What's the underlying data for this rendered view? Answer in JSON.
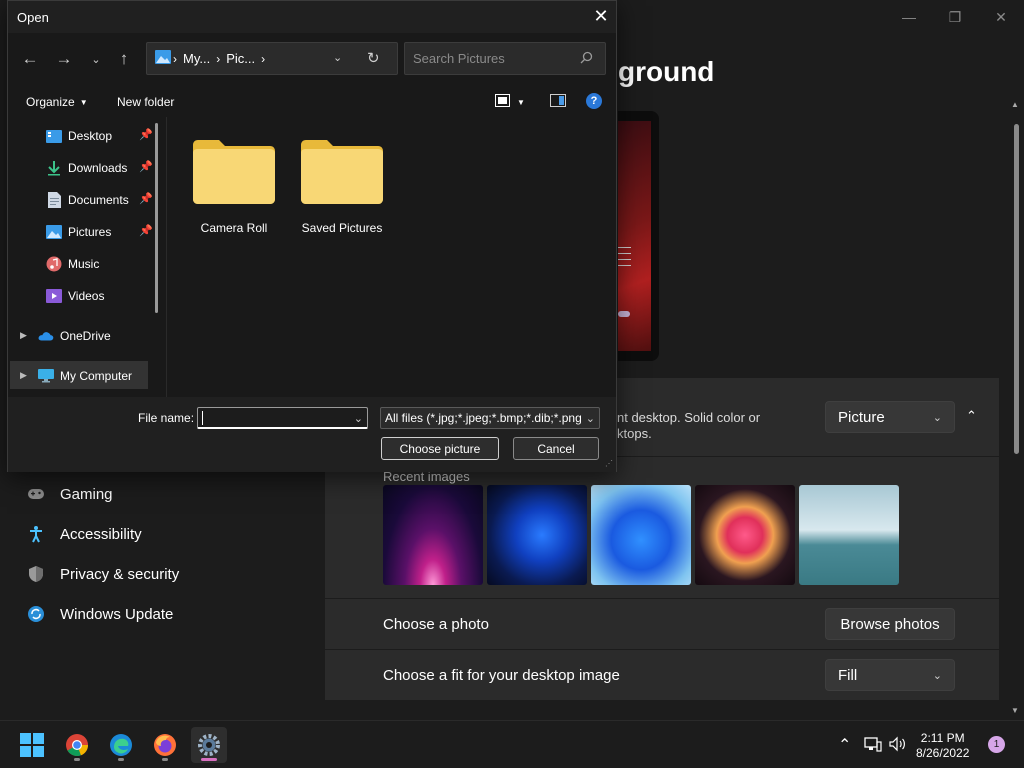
{
  "dialog": {
    "title": "Open",
    "address_segments": [
      "My...",
      "Pic..."
    ],
    "search_placeholder": "Search Pictures",
    "toolbar": {
      "organize": "Organize",
      "new_folder": "New folder"
    },
    "sidebar": [
      {
        "label": "Desktop",
        "icon": "desktop-icon",
        "pinned": true
      },
      {
        "label": "Downloads",
        "icon": "download-icon",
        "pinned": true
      },
      {
        "label": "Documents",
        "icon": "documents-icon",
        "pinned": true
      },
      {
        "label": "Pictures",
        "icon": "pictures-icon",
        "pinned": true
      },
      {
        "label": "Music",
        "icon": "music-icon",
        "pinned": false
      },
      {
        "label": "Videos",
        "icon": "videos-icon",
        "pinned": false
      },
      {
        "label": "OneDrive",
        "icon": "onedrive-icon",
        "pinned": false
      },
      {
        "label": "My Computer",
        "icon": "computer-icon",
        "pinned": false
      }
    ],
    "selected_sidebar": "My Computer",
    "folders": [
      "Camera Roll",
      "Saved Pictures"
    ],
    "file_name_label": "File name:",
    "file_name_value": "",
    "file_type": "All files (*.jpg;*.jpeg;*.bmp;*.dib;*.png",
    "buttons": {
      "choose": "Choose picture",
      "cancel": "Cancel"
    }
  },
  "settings": {
    "page_title_partial": "ground",
    "background_desc_line1": "nt desktop. Solid color or",
    "background_desc_line2": "ktops.",
    "background_type": "Picture",
    "recent_images_label": "Recent images",
    "recent_images": [
      "glow-icon",
      "bloom-blue-dark",
      "bloom-blue-light",
      "flow-pink",
      "lake-landscape"
    ],
    "choose_photo_label": "Choose a photo",
    "browse_button": "Browse photos",
    "fit_label": "Choose a fit for your desktop image",
    "fit_value": "Fill",
    "nav": [
      {
        "label": "Gaming",
        "icon": "gaming-icon"
      },
      {
        "label": "Accessibility",
        "icon": "accessibility-icon"
      },
      {
        "label": "Privacy & security",
        "icon": "shield-icon"
      },
      {
        "label": "Windows Update",
        "icon": "update-icon"
      }
    ]
  },
  "taskbar": {
    "apps": [
      "start-icon",
      "chrome-icon",
      "edge-icon",
      "firefox-icon",
      "settings-icon"
    ],
    "time": "2:11 PM",
    "date": "8/26/2022",
    "notifications": "1"
  },
  "colors": {
    "accent": "#4cc2ff",
    "folder": "#f8d775",
    "notification_badge": "#d6a6e8"
  }
}
